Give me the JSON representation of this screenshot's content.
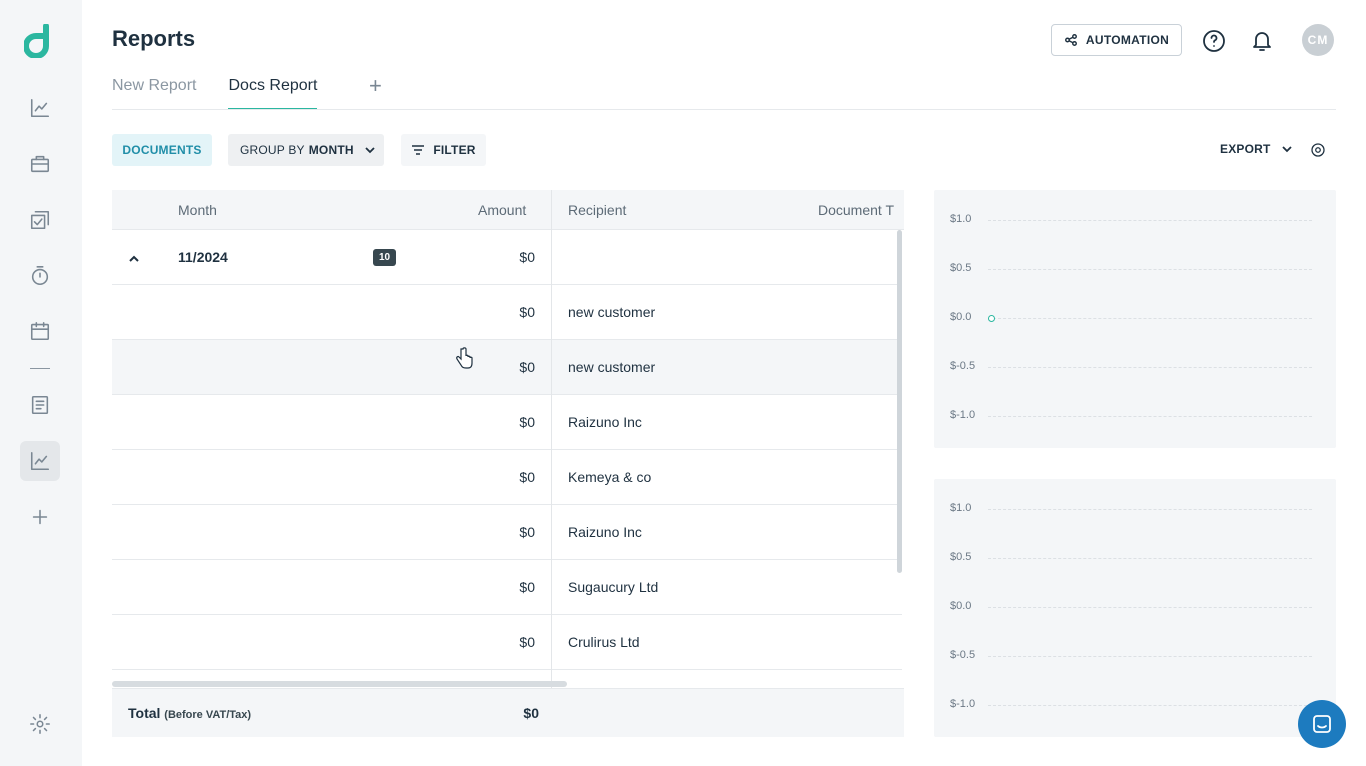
{
  "sidebar": {
    "nav": [
      "dashboard-chart",
      "briefcase",
      "checklist",
      "timer",
      "calendar",
      "document",
      "reports-chart",
      "add"
    ],
    "active": "reports-chart",
    "settings": "settings"
  },
  "header": {
    "title": "Reports",
    "automation_label": "AUTOMATION",
    "avatar_initials": "CM"
  },
  "tabs": [
    {
      "label": "New Report",
      "active": false
    },
    {
      "label": "Docs Report",
      "active": true
    }
  ],
  "toolbar": {
    "documents_label": "DOCUMENTS",
    "group_by_prefix": "GROUP BY",
    "group_by_value": "MONTH",
    "filter_label": "FILTER",
    "export_label": "EXPORT"
  },
  "table": {
    "columns": [
      "Month",
      "Amount",
      "Recipient",
      "Document T"
    ],
    "group": {
      "month": "11/2024",
      "count": "10",
      "amount": "$0"
    },
    "rows": [
      {
        "amount": "$0",
        "recipient": "new customer"
      },
      {
        "amount": "$0",
        "recipient": "new customer"
      },
      {
        "amount": "$0",
        "recipient": "Raizuno Inc"
      },
      {
        "amount": "$0",
        "recipient": "Kemeya & co"
      },
      {
        "amount": "$0",
        "recipient": "Raizuno Inc"
      },
      {
        "amount": "$0",
        "recipient": "Sugaucury Ltd"
      },
      {
        "amount": "$0",
        "recipient": "Crulirus Ltd"
      }
    ],
    "total": {
      "label": "Total",
      "sub": "(Before VAT/Tax)",
      "value": "$0"
    }
  },
  "charts": [
    {
      "y_ticks": [
        "$1.0",
        "$0.5",
        "$0.0",
        "$-0.5",
        "$-1.0"
      ],
      "point_value": 0
    },
    {
      "y_ticks": [
        "$1.0",
        "$0.5",
        "$0.0",
        "$-0.5",
        "$-1.0"
      ]
    }
  ],
  "colors": {
    "accent": "#2bb7a0",
    "documents_text": "#208ea8",
    "chat": "#1d7bbf"
  }
}
